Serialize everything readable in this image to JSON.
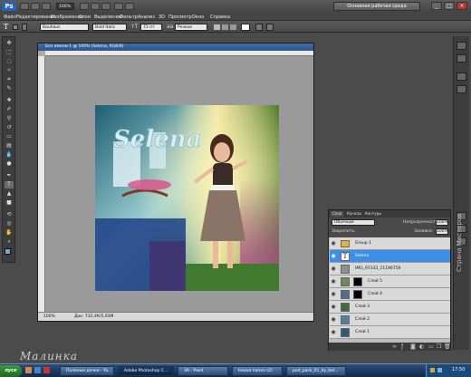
{
  "app": {
    "logo": "Ps",
    "zoom": "100%",
    "workspace": "Основная рабочая среда"
  },
  "menu": [
    "Файл",
    "Редактирование",
    "Изображение",
    "Слои",
    "Выделение",
    "Фильтр",
    "Анализ",
    "3D",
    "Просмотр",
    "Окно",
    "Справка"
  ],
  "options": {
    "tool_glyph": "T",
    "font_family": "Bauhaus",
    "font_style": "Bold Italic",
    "font_size": "72 пт",
    "aa": "Резкое"
  },
  "document": {
    "title": "Без имени-1 @ 100% (Selena, RGB/8)",
    "zoom": "100%",
    "doc_info": "Док: 732,4К/5,93М",
    "art_text": "Selena"
  },
  "layers_panel": {
    "tabs": [
      "Слои",
      "Каналы",
      "Контуры"
    ],
    "blend_mode": "Обычные",
    "opacity_label": "Непрозрачность:",
    "opacity": "100%",
    "lock_label": "Закрепить:",
    "fill_label": "Заливка:",
    "fill": "100%",
    "layers": [
      {
        "name": "Group 1",
        "type": "group"
      },
      {
        "name": "Selena",
        "type": "text",
        "selected": true
      },
      {
        "name": "IMG_97333_11196759",
        "type": "image"
      },
      {
        "name": "Слой 5",
        "type": "image"
      },
      {
        "name": "Слой 4",
        "type": "image"
      },
      {
        "name": "Слой 3",
        "type": "image"
      },
      {
        "name": "Слой 2",
        "type": "image"
      },
      {
        "name": "Слой 1",
        "type": "image"
      }
    ]
  },
  "taskbar": {
    "start": "пуск",
    "items": [
      "Паленые дочки - Ya...",
      "Adobe Photoshop C...",
      "3A - Paint",
      "Новая папка (2)",
      "pod_pack_01_by_bel..."
    ],
    "time": "17:50"
  },
  "watermarks": {
    "left": "Малинка",
    "right": "Страна Мастеров"
  }
}
